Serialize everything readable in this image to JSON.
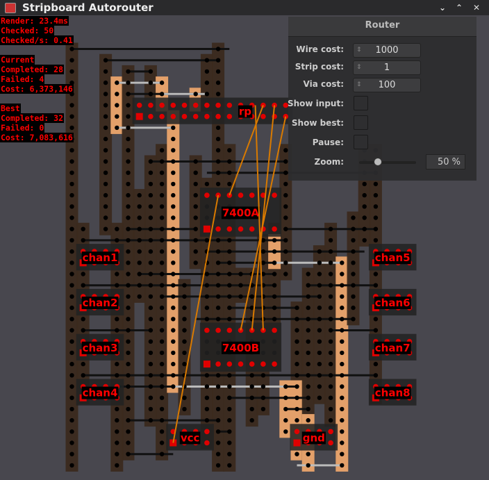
{
  "window": {
    "title": "Stripboard Autorouter",
    "buttons": [
      "⌄",
      "⌃",
      "✕"
    ]
  },
  "stats": {
    "render": "Render: 23.4ms",
    "checked": "Checked: 50",
    "checked_per_s": "Checked/s: 0.41",
    "current": {
      "heading": "Current",
      "completed": "Completed: 28",
      "failed": "Failed: 4",
      "cost": "Cost: 6,373,146"
    },
    "best": {
      "heading": "Best",
      "completed": "Completed: 32",
      "failed": "Failed: 0",
      "cost": "Cost: 7,083,616"
    }
  },
  "panel": {
    "title": "Router",
    "wire_cost_label": "Wire cost:",
    "wire_cost": "1000",
    "strip_cost_label": "Strip cost:",
    "strip_cost": "1",
    "via_cost_label": "Via cost:",
    "via_cost": "100",
    "show_input_label": "Show input:",
    "show_best_label": "Show best:",
    "pause_label": "Pause:",
    "zoom_label": "Zoom:",
    "zoom_value": "50 %",
    "zoom_percent": 50
  },
  "components": [
    "rp",
    "7400A",
    "7400B",
    "chan1",
    "chan2",
    "chan3",
    "chan4",
    "chan5",
    "chan6",
    "chan7",
    "chan8",
    "vcc",
    "gnd"
  ],
  "colors": {
    "background": "#48474e",
    "strip": "#3b2a1e",
    "strip_power": "#e3a06a",
    "pin": "#e00000",
    "ratsnest": "#d97a00",
    "label": "#ff0000"
  }
}
